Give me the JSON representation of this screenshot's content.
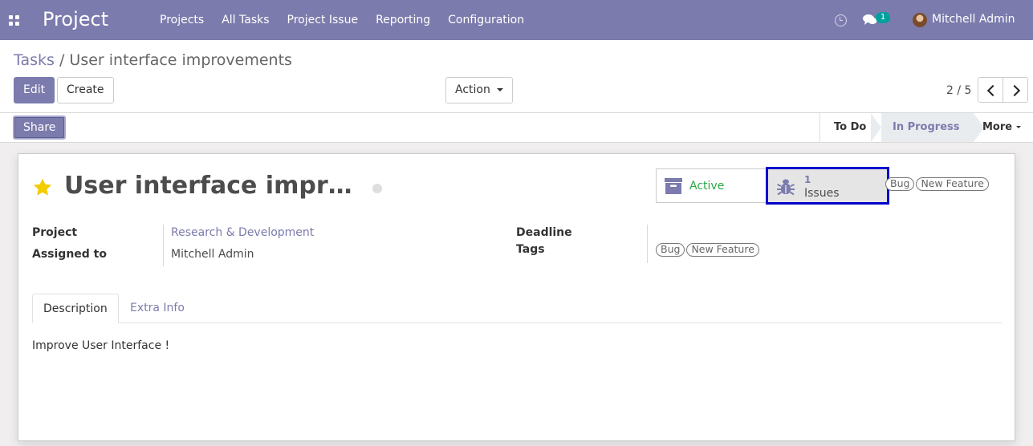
{
  "navbar": {
    "app_name": "Project",
    "menu": [
      "Projects",
      "All Tasks",
      "Project Issue",
      "Reporting",
      "Configuration"
    ],
    "chat_badge": "1",
    "user_name": "Mitchell Admin",
    "icons": [
      "apps-grid-icon",
      "clock-icon",
      "chat-icon",
      "avatar"
    ],
    "color": "#7c7bad"
  },
  "breadcrumb": {
    "parent": "Tasks",
    "separator": "/",
    "current": "User interface improvements"
  },
  "toolbar": {
    "edit_label": "Edit",
    "create_label": "Create",
    "action_label": "Action"
  },
  "pager": {
    "value": "2 / 5"
  },
  "statusbar": {
    "share_label": "Share",
    "stages": [
      "To Do",
      "In Progress",
      "More"
    ],
    "current_stage": "In Progress"
  },
  "record": {
    "title": "User interface improvements",
    "favorite": true,
    "active_label": "Active",
    "issues_count": "1",
    "issues_label": "Issues",
    "header_tags": [
      "Bug",
      "New Feature"
    ],
    "fields": {
      "project_label": "Project",
      "project_value": "Research & Development",
      "assigned_label": "Assigned to",
      "assigned_value": "Mitchell Admin",
      "deadline_label": "Deadline",
      "deadline_value": "",
      "tags_label": "Tags",
      "tags": [
        "Bug",
        "New Feature"
      ]
    },
    "tabs": [
      "Description",
      "Extra Info"
    ],
    "active_tab": "Description",
    "description": "Improve User Interface !"
  },
  "colors": {
    "brand": "#7c7bad",
    "active_green": "#28a745",
    "badge_teal": "#00a09d",
    "highlight_outline": "#0000cc",
    "star_yellow": "#f3cc00"
  }
}
